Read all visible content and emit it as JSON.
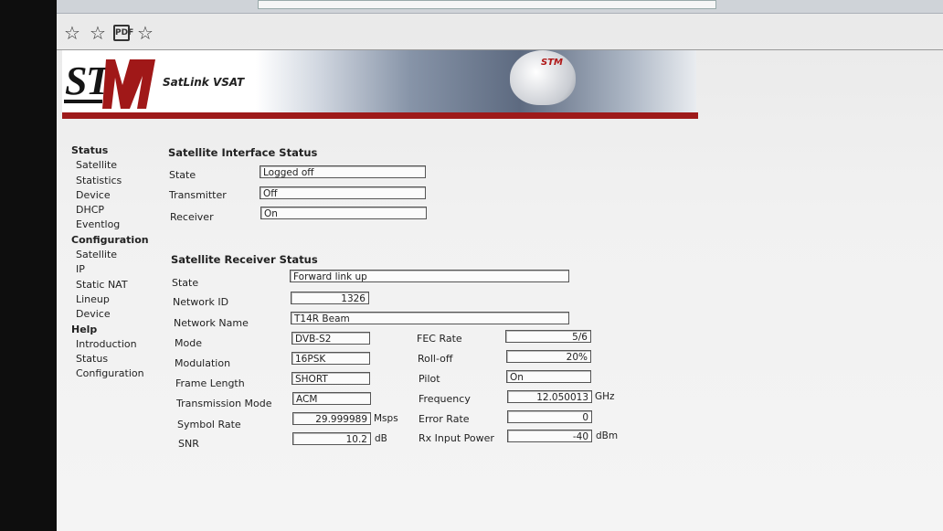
{
  "toolbar": {
    "icons": [
      "star-icon",
      "star-icon",
      "pdf-icon",
      "star-icon"
    ],
    "pdf_label": "PDF"
  },
  "header": {
    "logo_text": "STM",
    "brand": "SatLink VSAT",
    "dish_logo": "STM",
    "accent": "#9e1a1a"
  },
  "nav": {
    "status_heading": "Status",
    "status_items": [
      "Satellite",
      "Statistics",
      "Device",
      "DHCP",
      "Eventlog"
    ],
    "config_heading": "Configuration",
    "config_items": [
      "Satellite",
      "IP",
      "Static NAT",
      "Lineup",
      "Device"
    ],
    "help_heading": "Help",
    "help_items": [
      "Introduction",
      "Status",
      "Configuration"
    ]
  },
  "interface_status": {
    "title": "Satellite Interface Status",
    "state_label": "State",
    "state": "Logged off",
    "transmitter_label": "Transmitter",
    "transmitter": "Off",
    "receiver_label": "Receiver",
    "receiver": "On"
  },
  "receiver_status": {
    "title": "Satellite Receiver Status",
    "state_label": "State",
    "state": "Forward link up",
    "network_id_label": "Network ID",
    "network_id": "1326",
    "network_name_label": "Network Name",
    "network_name": "T14R Beam",
    "mode_label": "Mode",
    "mode": "DVB-S2",
    "modulation_label": "Modulation",
    "modulation": "16PSK",
    "frame_length_label": "Frame Length",
    "frame_length": "SHORT",
    "transmission_mode_label": "Transmission Mode",
    "transmission_mode": "ACM",
    "symbol_rate_label": "Symbol Rate",
    "symbol_rate": "29.999989",
    "symbol_rate_unit": "Msps",
    "snr_label": "SNR",
    "snr": "10.2",
    "snr_unit": "dB",
    "fec_rate_label": "FEC Rate",
    "fec_rate": "5/6",
    "rolloff_label": "Roll-off",
    "rolloff": "20%",
    "pilot_label": "Pilot",
    "pilot": "On",
    "frequency_label": "Frequency",
    "frequency": "12.050013",
    "frequency_unit": "GHz",
    "error_rate_label": "Error Rate",
    "error_rate": "0",
    "rx_power_label": "Rx Input Power",
    "rx_power": "-40",
    "rx_power_unit": "dBm"
  }
}
